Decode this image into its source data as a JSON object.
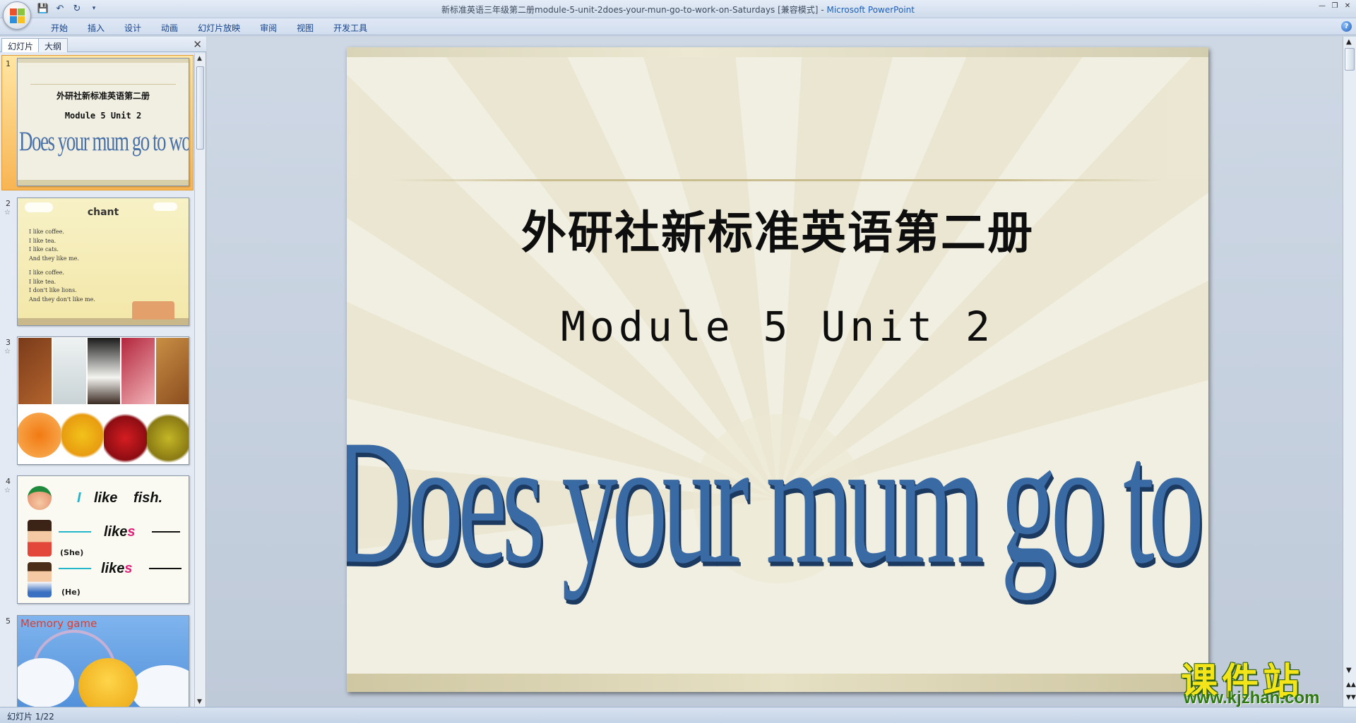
{
  "window": {
    "title": "新标准英语三年级第二册module-5-unit-2does-your-mun-go-to-work-on-Saturdays [兼容模式]",
    "app_name": "Microsoft PowerPoint",
    "separator": " - "
  },
  "ribbon": {
    "tabs": [
      "开始",
      "插入",
      "设计",
      "动画",
      "幻灯片放映",
      "审阅",
      "视图",
      "开发工具"
    ]
  },
  "left_pane": {
    "tabs": [
      "幻灯片",
      "大纲"
    ],
    "active_tab": "幻灯片",
    "close": "✕"
  },
  "thumbnails": [
    {
      "number": "1",
      "title": "外研社新标准英语第二册",
      "subtitle": "Module 5 Unit 2",
      "big": "Does your mum go to work on Saturdays?"
    },
    {
      "number": "2",
      "title": "chant",
      "lines_a": [
        "I like coffee.",
        "I like tea.",
        "I like cats.",
        "And they like me."
      ],
      "lines_b": [
        "I like coffee.",
        "I  like  tea.",
        "I don't like lions.",
        "And they don't like me."
      ]
    },
    {
      "number": "3"
    },
    {
      "number": "4",
      "row1": [
        "I",
        "like",
        "fish."
      ],
      "row2_likes": "like",
      "row2_s": "s",
      "she": "(She)",
      "he": "(He)"
    },
    {
      "number": "5",
      "title": "Memory  game"
    }
  ],
  "slide": {
    "title": "外研社新标准英语第二册",
    "subtitle": "Module 5 Unit 2",
    "headline": "Does your mum go to work on Saturdays?"
  },
  "watermark": {
    "cn": "课件站",
    "url": "www.kjzhan.com"
  },
  "status": {
    "slide_counter": "幻灯片 1/22"
  },
  "colors": {
    "headline": "#3a6aa3",
    "selection": "#f8b553",
    "watermark_yellow": "#f4e51b",
    "watermark_green": "#2f7a10"
  }
}
